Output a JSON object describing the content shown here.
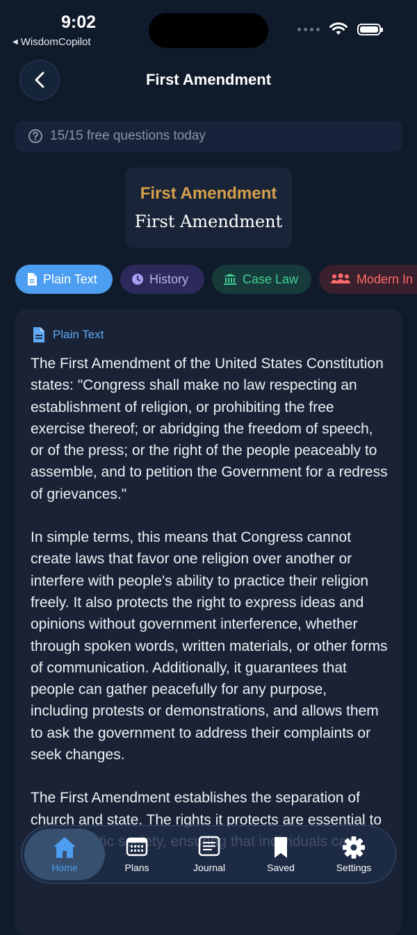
{
  "status": {
    "time": "9:02",
    "back_app": "WisdomCopilot"
  },
  "header": {
    "title": "First Amendment"
  },
  "quota": {
    "text": "15/15 free questions today"
  },
  "amendment_card": {
    "title": "First Amendment",
    "subtitle": "First Amendment"
  },
  "tabs": [
    {
      "label": "Plain Text",
      "icon": "document-icon",
      "selected": true
    },
    {
      "label": "History",
      "icon": "clock-icon"
    },
    {
      "label": "Case Law",
      "icon": "bank-icon"
    },
    {
      "label": "Modern In",
      "icon": "people-icon"
    }
  ],
  "content": {
    "heading": "Plain Text",
    "paragraphs": [
      "The First Amendment of the United States Constitution states: \"Congress shall make no law respecting an establishment of religion, or prohibiting the free exercise thereof; or abridging the freedom of speech, or of the press; or the right of the people peaceably to assemble, and to petition the Government for a redress of grievances.\"",
      "In simple terms, this means that Congress cannot create laws that favor one religion over another or interfere with people's ability to practice their religion freely. It also protects the right to express ideas and opinions without government interference, whether through spoken words, written materials, or other forms of communication. Additionally, it guarantees that people can gather peacefully for any purpose, including protests or demonstrations, and allows them to ask the government to address their complaints or seek changes.",
      "The First Amendment establishes the separation of church and state. The rights it protects are essential to a democratic society, ensuring that individuals can"
    ]
  },
  "tabbar": [
    {
      "label": "Home",
      "icon": "home-icon",
      "active": true
    },
    {
      "label": "Plans",
      "icon": "calendar-icon"
    },
    {
      "label": "Journal",
      "icon": "journal-icon"
    },
    {
      "label": "Saved",
      "icon": "bookmark-icon"
    },
    {
      "label": "Settings",
      "icon": "gear-icon"
    }
  ],
  "colors": {
    "accent": "#4d9ef0",
    "gold": "#d6a04a",
    "history": "#b8b4f0",
    "caselaw": "#42d196",
    "modern": "#ff6b6b"
  }
}
